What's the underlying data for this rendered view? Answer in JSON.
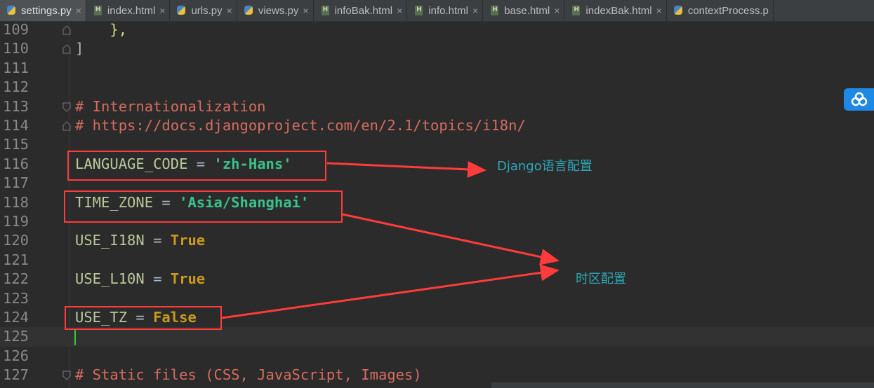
{
  "tabs": [
    {
      "label": "settings.py",
      "icon": "python-file-icon",
      "active": true
    },
    {
      "label": "index.html",
      "icon": "html-file-icon"
    },
    {
      "label": "urls.py",
      "icon": "python-file-icon"
    },
    {
      "label": "views.py",
      "icon": "python-file-icon"
    },
    {
      "label": "infoBak.html",
      "icon": "html-file-icon"
    },
    {
      "label": "info.html",
      "icon": "html-file-icon"
    },
    {
      "label": "base.html",
      "icon": "html-file-icon"
    },
    {
      "label": "indexBak.html",
      "icon": "html-file-icon"
    },
    {
      "label": "contextProcess.p",
      "icon": "python-file-icon"
    }
  ],
  "close_glyph": "×",
  "lines": [
    {
      "n": "109",
      "parts": [
        {
          "t": "    },",
          "c": "punc"
        }
      ]
    },
    {
      "n": "110",
      "parts": [
        {
          "t": "]",
          "c": "plain"
        }
      ]
    },
    {
      "n": "111",
      "parts": []
    },
    {
      "n": "112",
      "parts": []
    },
    {
      "n": "113",
      "parts": [
        {
          "t": "# Internationalization",
          "c": "comment"
        }
      ]
    },
    {
      "n": "114",
      "parts": [
        {
          "t": "# https://docs.djangoproject.com/en/2.1/topics/i18n/",
          "c": "comment"
        }
      ]
    },
    {
      "n": "115",
      "parts": []
    },
    {
      "n": "116",
      "parts": [
        {
          "t": "LANGUAGE_CODE",
          "c": "var"
        },
        {
          "t": " = ",
          "c": "plain"
        },
        {
          "t": "'zh-Hans'",
          "c": "str"
        }
      ]
    },
    {
      "n": "117",
      "parts": []
    },
    {
      "n": "118",
      "parts": [
        {
          "t": "TIME_ZONE",
          "c": "var"
        },
        {
          "t": " = ",
          "c": "plain"
        },
        {
          "t": "'Asia/Shanghai'",
          "c": "str"
        }
      ]
    },
    {
      "n": "119",
      "parts": []
    },
    {
      "n": "120",
      "parts": [
        {
          "t": "USE_I18N",
          "c": "var"
        },
        {
          "t": " = ",
          "c": "plain"
        },
        {
          "t": "True",
          "c": "kw"
        }
      ]
    },
    {
      "n": "121",
      "parts": []
    },
    {
      "n": "122",
      "parts": [
        {
          "t": "USE_L10N",
          "c": "var"
        },
        {
          "t": " = ",
          "c": "plain"
        },
        {
          "t": "True",
          "c": "kw"
        }
      ]
    },
    {
      "n": "123",
      "parts": []
    },
    {
      "n": "124",
      "parts": [
        {
          "t": "USE_TZ",
          "c": "var"
        },
        {
          "t": " = ",
          "c": "plain"
        },
        {
          "t": "False",
          "c": "kw"
        }
      ]
    },
    {
      "n": "125",
      "parts": [],
      "current": true
    },
    {
      "n": "126",
      "parts": []
    },
    {
      "n": "127",
      "parts": [
        {
          "t": "# Static files (CSS, JavaScript, Images)",
          "c": "comment"
        }
      ]
    }
  ],
  "annotations": {
    "language_note": "Django语言配置",
    "timezone_note": "时区配置"
  },
  "colors": {
    "background": "#2b2b2b",
    "annotation_red": "#ff3b3b",
    "annotation_text": "#2aa8b8",
    "caret": "#33cc33"
  }
}
